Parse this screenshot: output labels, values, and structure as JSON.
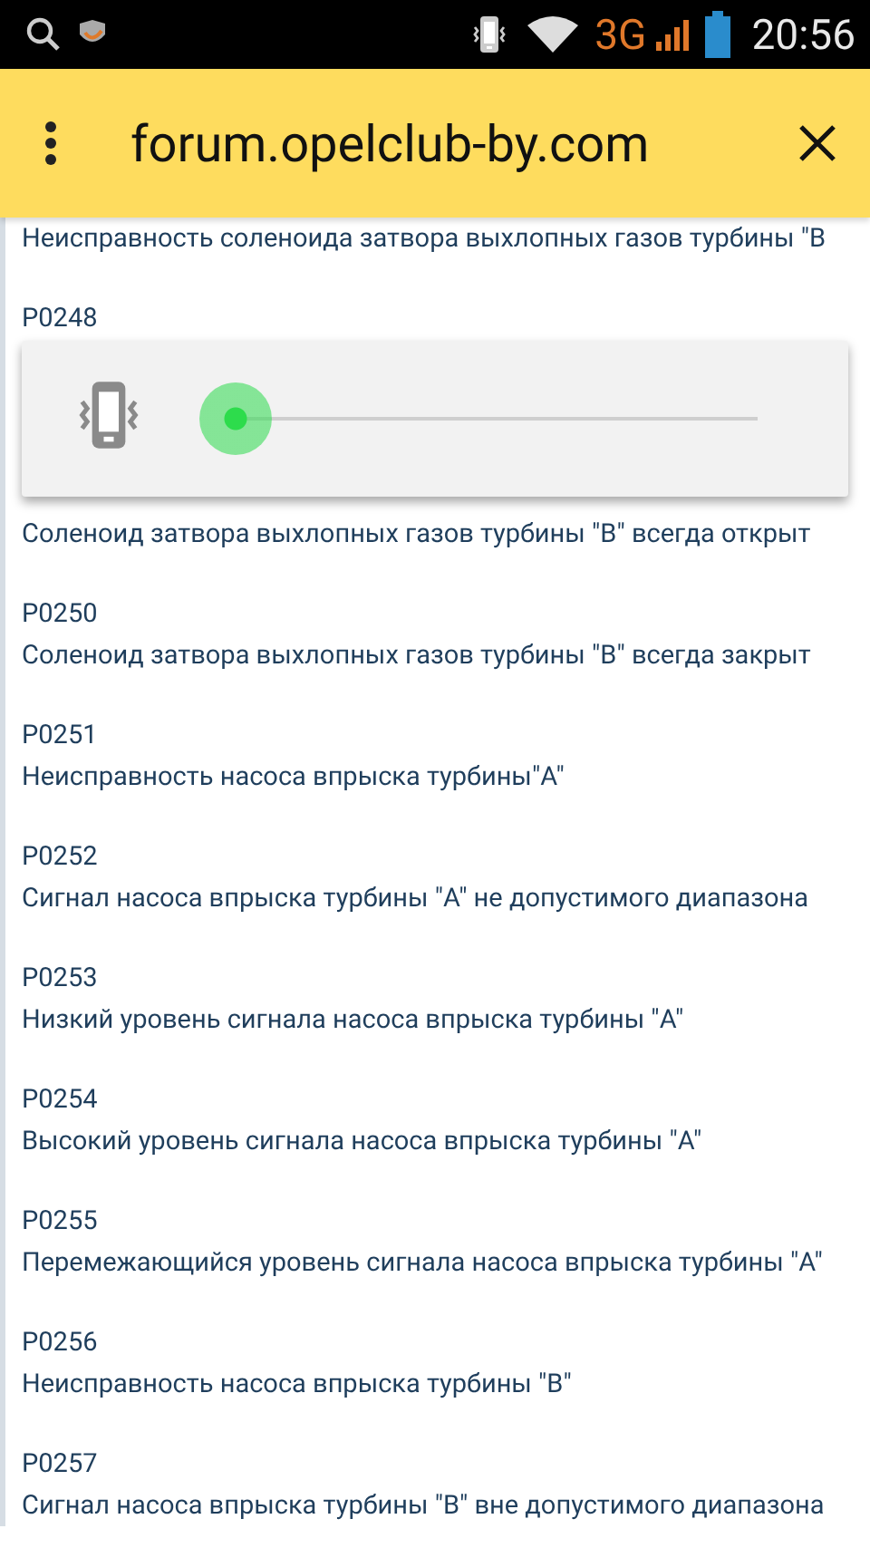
{
  "status_bar": {
    "network": "3G",
    "time": "20:56"
  },
  "toolbar": {
    "title": "forum.opelclub-by.com"
  },
  "entries": [
    {
      "description": "Неисправность соленоида затвора выхлопных газов турбины \"B"
    },
    {
      "code": "P0248"
    },
    {
      "description": "Соленоид затвора выхлопных газов турбины \"B\" всегда открыт"
    },
    {
      "code": "P0250",
      "description": "Соленоид затвора выхлопных газов турбины \"B\" всегда закрыт"
    },
    {
      "code": "P0251",
      "description": "Неисправность насоса впрыска турбины\"A\""
    },
    {
      "code": "P0252",
      "description": "Сигнал насоса впрыска турбины \"A\" не допустимого диапазона"
    },
    {
      "code": "P0253",
      "description": "Низкий уровень сигнала насоса впрыска турбины \"A\""
    },
    {
      "code": "P0254",
      "description": "Высокий уровень сигнала насоса впрыска турбины \"A\""
    },
    {
      "code": "P0255",
      "description": "Перемежающийся уровень сигнала насоса впрыска турбины \"A\""
    },
    {
      "code": "P0256",
      "description": "Неисправность насоса впрыска турбины \"B\""
    },
    {
      "code": "P0257",
      "description": "Сигнал насоса впрыска турбины \"B\" вне допустимого диапазона"
    }
  ],
  "volume_popup": {
    "level": 0
  }
}
